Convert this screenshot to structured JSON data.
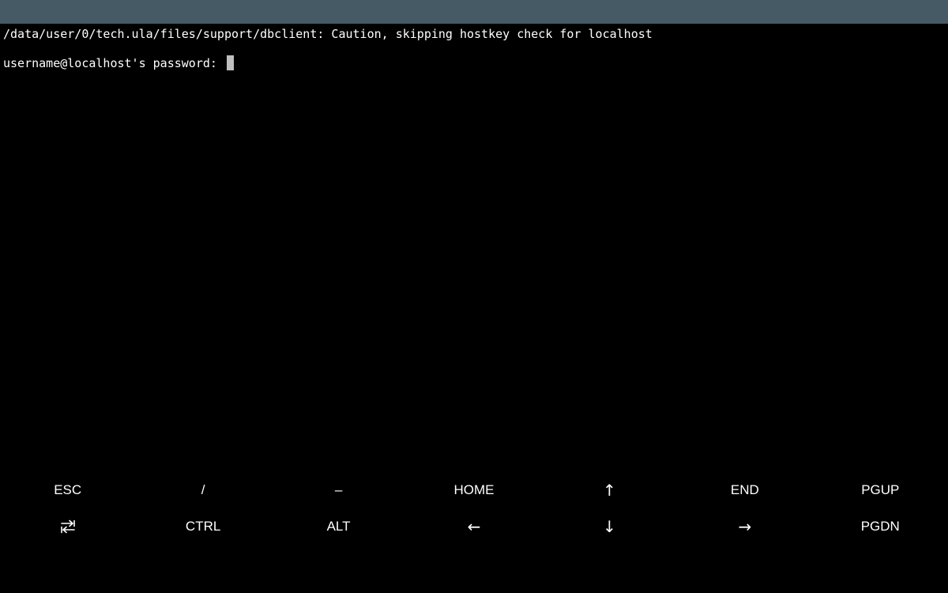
{
  "terminal": {
    "lines": [
      "/data/user/0/tech.ula/files/support/dbclient: Caution, skipping hostkey check for localhost",
      "username@localhost's password: "
    ]
  },
  "extra_keys": {
    "row1": {
      "esc": "ESC",
      "slash": "/",
      "dash": "–",
      "home": "HOME",
      "up": "↑",
      "end": "END",
      "pgup": "PGUP"
    },
    "row2": {
      "tab_icon": "tab-icon",
      "ctrl": "CTRL",
      "alt": "ALT",
      "left": "←",
      "down": "↓",
      "right": "→",
      "pgdn": "PGDN"
    }
  },
  "colors": {
    "status_bar": "#455a64",
    "background": "#000000",
    "text": "#ffffff",
    "cursor": "#bfbfbf"
  }
}
